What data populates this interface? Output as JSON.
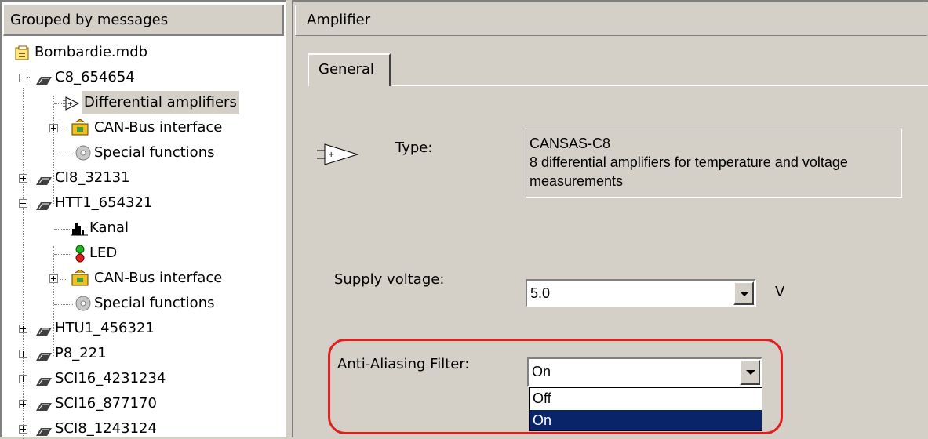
{
  "tree": {
    "header": "Grouped by messages",
    "root": "Bombardie.mdb",
    "nodes": [
      {
        "label": "C8_654654"
      },
      {
        "label": "Differential amplifiers"
      },
      {
        "label": "CAN-Bus interface"
      },
      {
        "label": "Special functions"
      },
      {
        "label": "CI8_32131"
      },
      {
        "label": "HTT1_654321"
      },
      {
        "label": "Kanal"
      },
      {
        "label": "LED"
      },
      {
        "label": "CAN-Bus interface"
      },
      {
        "label": "Special functions"
      },
      {
        "label": "HTU1_456321"
      },
      {
        "label": "P8_221"
      },
      {
        "label": "SCI16_4231234"
      },
      {
        "label": "SCI16_877170"
      },
      {
        "label": "SCI8_1243124"
      }
    ]
  },
  "panel": {
    "title": "Amplifier",
    "tab": "General",
    "type_label": "Type:",
    "type_value_line1": "CANSAS-C8",
    "type_value_line2": "8 differential amplifiers for temperature and voltage",
    "type_value_line3": "measurements",
    "supply_label": "Supply voltage:",
    "supply_value": "5.0",
    "supply_unit": "V",
    "filter_label": "Anti-Aliasing Filter:",
    "filter_value": "On",
    "filter_options": [
      "Off",
      "On"
    ],
    "filter_selected": "On"
  },
  "colors": {
    "highlight_ring": "#e02020",
    "selection": "#0a246a",
    "window_bg": "#d4d0c8"
  },
  "icons": {
    "database": "database-icon",
    "module": "module-icon",
    "amplifier": "amplifier-icon",
    "can_bus": "can-bus-icon",
    "gear": "gear-icon",
    "channel": "channel-icon",
    "led": "led-icon"
  }
}
